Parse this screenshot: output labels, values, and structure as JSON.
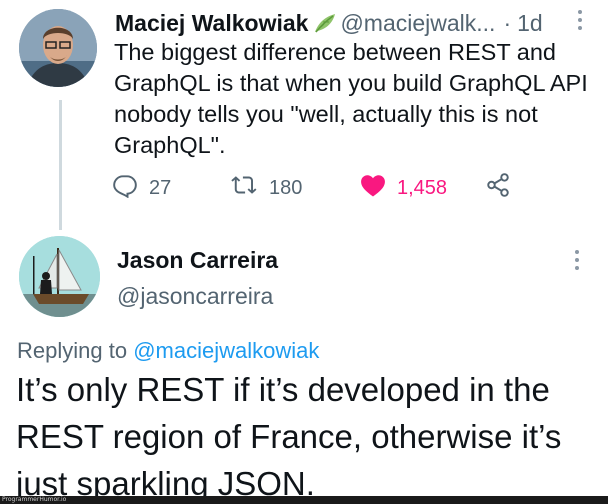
{
  "tweet1": {
    "name": "Maciej Walkowiak",
    "handle": "@maciejwalk...",
    "dot": "·",
    "time": "1d",
    "text": "The biggest difference between REST and GraphQL is that when you build GraphQL API nobody tells you \"well, actually this is not GraphQL\".",
    "replies": "27",
    "retweets": "180",
    "likes": "1,458",
    "verified_icon": "leaf-icon",
    "like_color": "#f91880"
  },
  "tweet2": {
    "name": "Jason Carreira",
    "handle": "@jasoncarreira",
    "replying_prefix": "Replying to",
    "replying_mention": "@maciejwalkowiak",
    "text": "It’s only REST if it’s developed in the REST region of France, otherwise it’s just sparkling JSON.",
    "mention_color": "#1d9bf0"
  },
  "watermark": "ProgrammerHumor.io"
}
